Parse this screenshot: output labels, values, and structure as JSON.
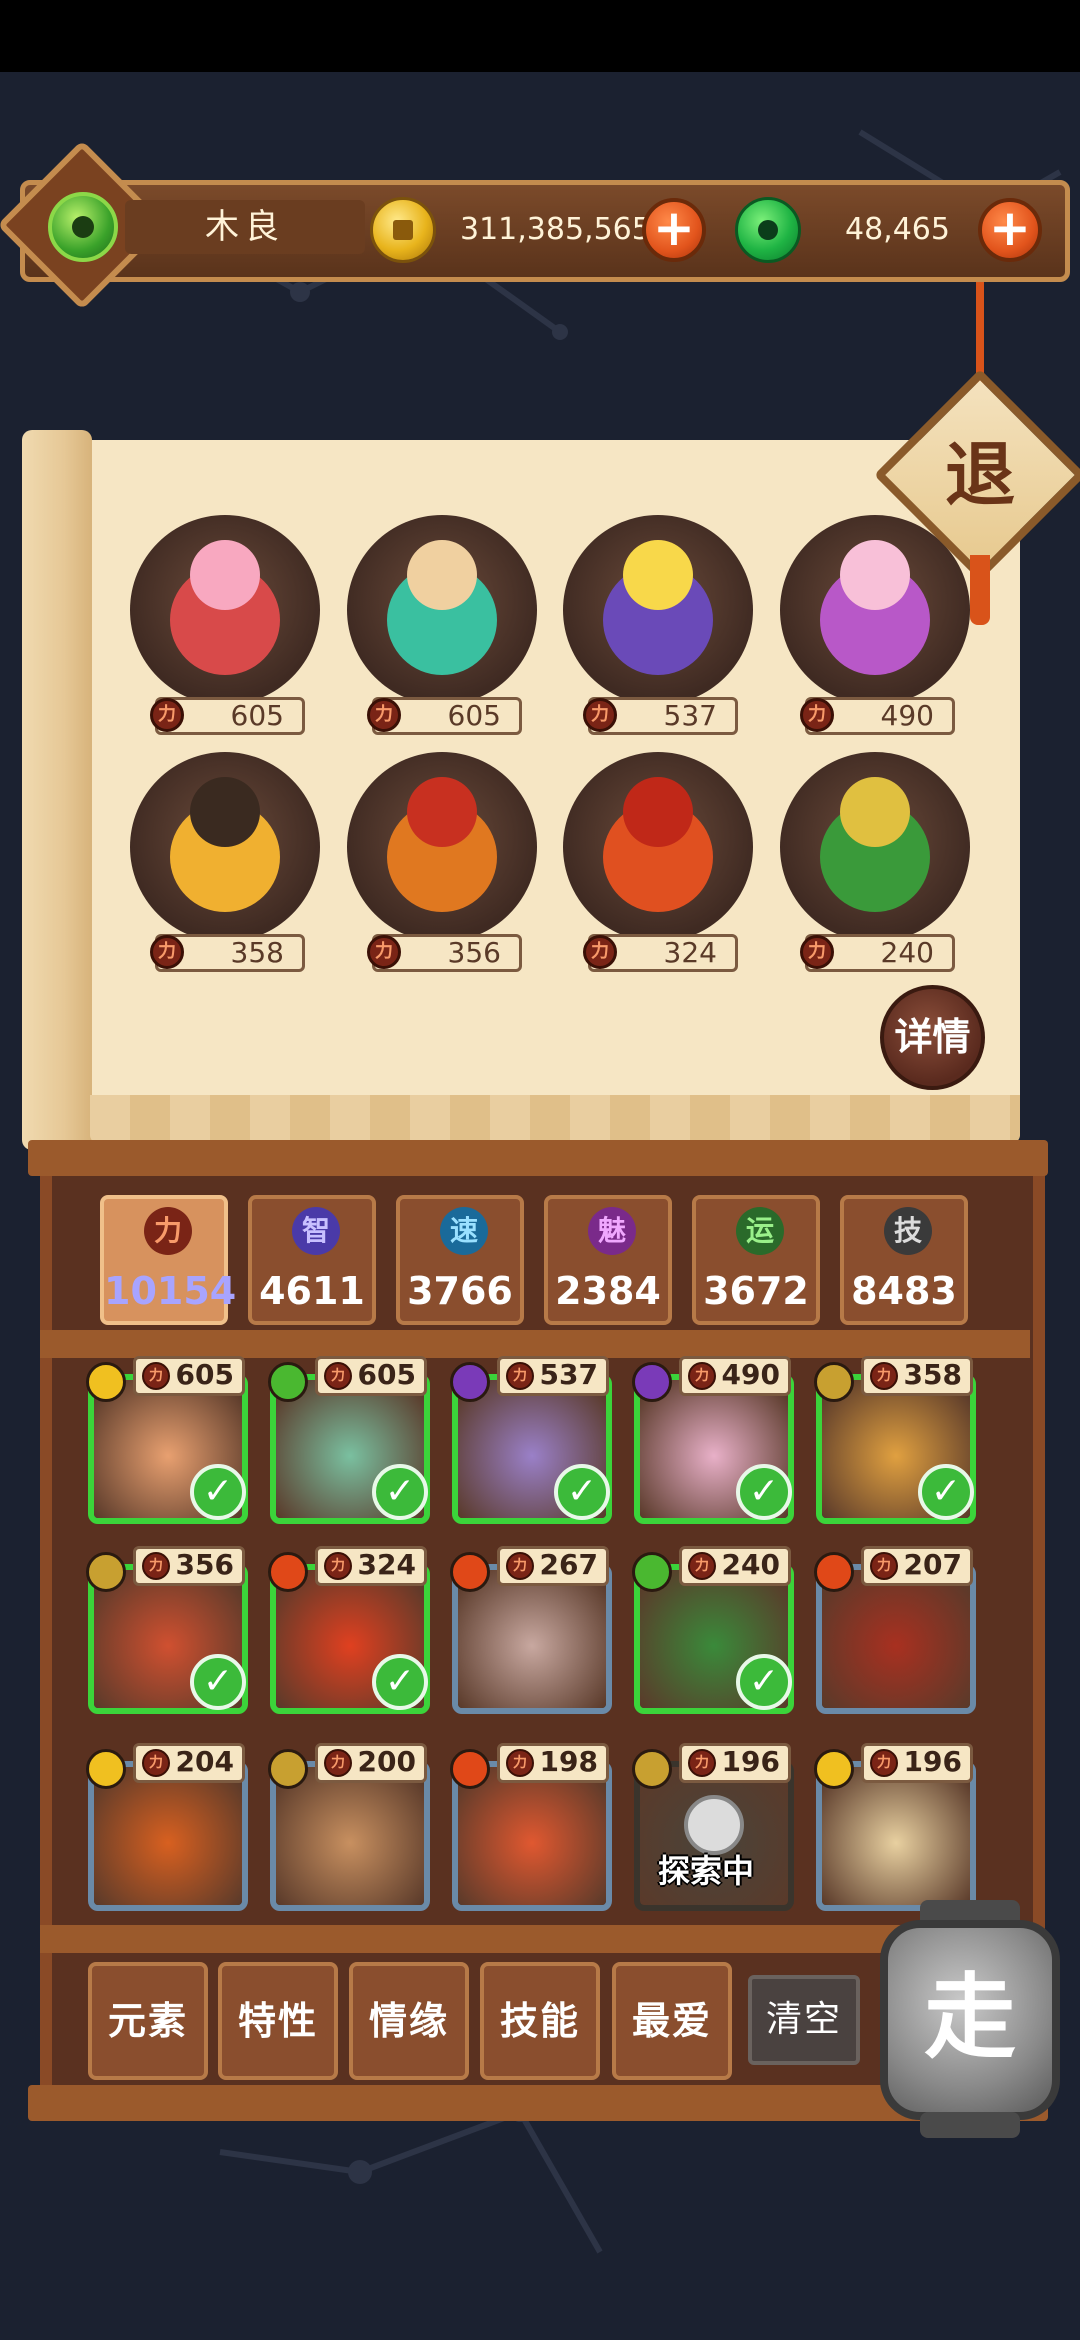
{
  "header": {
    "player_name": "木良",
    "coins": "311,385,565",
    "jade": "48,465",
    "plus_label": "+"
  },
  "retreat_label": "退",
  "detail_label": "详情",
  "featured": [
    {
      "score": "605"
    },
    {
      "score": "605"
    },
    {
      "score": "537"
    },
    {
      "score": "490"
    },
    {
      "score": "358"
    },
    {
      "score": "356"
    },
    {
      "score": "324"
    },
    {
      "score": "240"
    }
  ],
  "stats": [
    {
      "label": "力",
      "value": "10154",
      "color": "#7a2416",
      "text_color": "#f89a6a"
    },
    {
      "label": "智",
      "value": "4611",
      "color": "#4a3aa8",
      "text_color": "#c8c0ff"
    },
    {
      "label": "速",
      "value": "3766",
      "color": "#1a6a9a",
      "text_color": "#9ae0ff"
    },
    {
      "label": "魅",
      "value": "2384",
      "color": "#7a2a8a",
      "text_color": "#f0a8ff"
    },
    {
      "label": "运",
      "value": "3672",
      "color": "#2a6a2a",
      "text_color": "#9af08a"
    },
    {
      "label": "技",
      "value": "8483",
      "color": "#3a3a3a",
      "text_color": "#dcdcdc"
    }
  ],
  "heroes": [
    {
      "score": "605",
      "element": "sun",
      "selected": true
    },
    {
      "score": "605",
      "element": "leaf",
      "selected": true
    },
    {
      "score": "537",
      "element": "moon",
      "selected": true
    },
    {
      "score": "490",
      "element": "moon",
      "selected": true
    },
    {
      "score": "358",
      "element": "earth",
      "selected": true
    },
    {
      "score": "356",
      "element": "earth",
      "selected": true
    },
    {
      "score": "324",
      "element": "fire",
      "selected": true
    },
    {
      "score": "267",
      "element": "fire",
      "selected": false
    },
    {
      "score": "240",
      "element": "leaf",
      "selected": true
    },
    {
      "score": "207",
      "element": "fire",
      "selected": false
    },
    {
      "score": "204",
      "element": "sun",
      "selected": false
    },
    {
      "score": "200",
      "element": "earth",
      "selected": false
    },
    {
      "score": "198",
      "element": "fire",
      "selected": false
    },
    {
      "score": "196",
      "element": "earth",
      "selected": false,
      "status": "探索中"
    },
    {
      "score": "196",
      "element": "sun",
      "selected": false
    }
  ],
  "filters": [
    "元素",
    "特性",
    "情缘",
    "技能",
    "最爱"
  ],
  "clear_label": "清空",
  "go_label": "走",
  "power_glyph": "力",
  "check_glyph": "✓"
}
